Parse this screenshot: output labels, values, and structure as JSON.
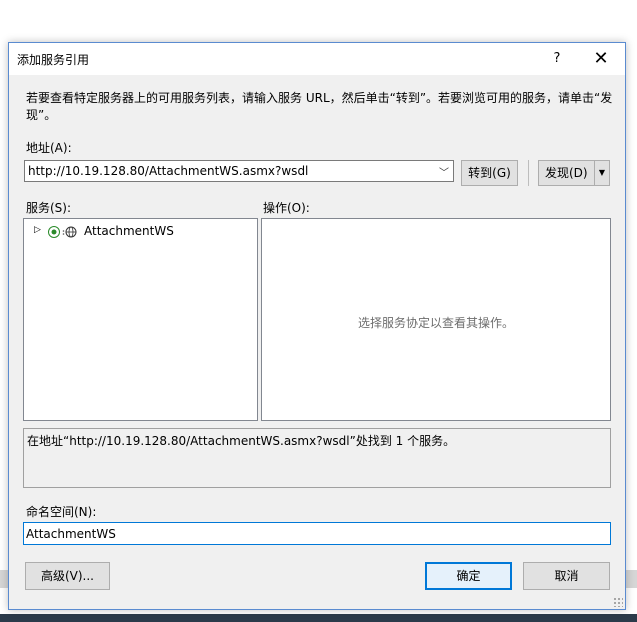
{
  "dialog": {
    "title": "添加服务引用",
    "help": "?",
    "close": "✕"
  },
  "description": "若要查看特定服务器上的可用服务列表，请输入服务 URL，然后单击“转到”。若要浏览可用的服务，请单击“发现”。",
  "address": {
    "label": "地址(A):",
    "value": "http://10.19.128.80/AttachmentWS.asmx?wsdl"
  },
  "buttons": {
    "go": "转到(G)",
    "discover": "发现(D)",
    "advanced": "高级(V)...",
    "ok": "确定",
    "cancel": "取消"
  },
  "services": {
    "label": "服务(S):",
    "items": [
      {
        "label": "AttachmentWS"
      }
    ]
  },
  "operations": {
    "label": "操作(O):",
    "hint": "选择服务协定以查看其操作。"
  },
  "status": "在地址“http://10.19.128.80/AttachmentWS.asmx?wsdl”处找到 1 个服务。",
  "namespace": {
    "label": "命名空间(N):",
    "value": "AttachmentWS"
  },
  "colors": {
    "accent": "#0078d7",
    "dialog_bg": "#f0f0f0",
    "hint_text": "#6d6d6d"
  }
}
